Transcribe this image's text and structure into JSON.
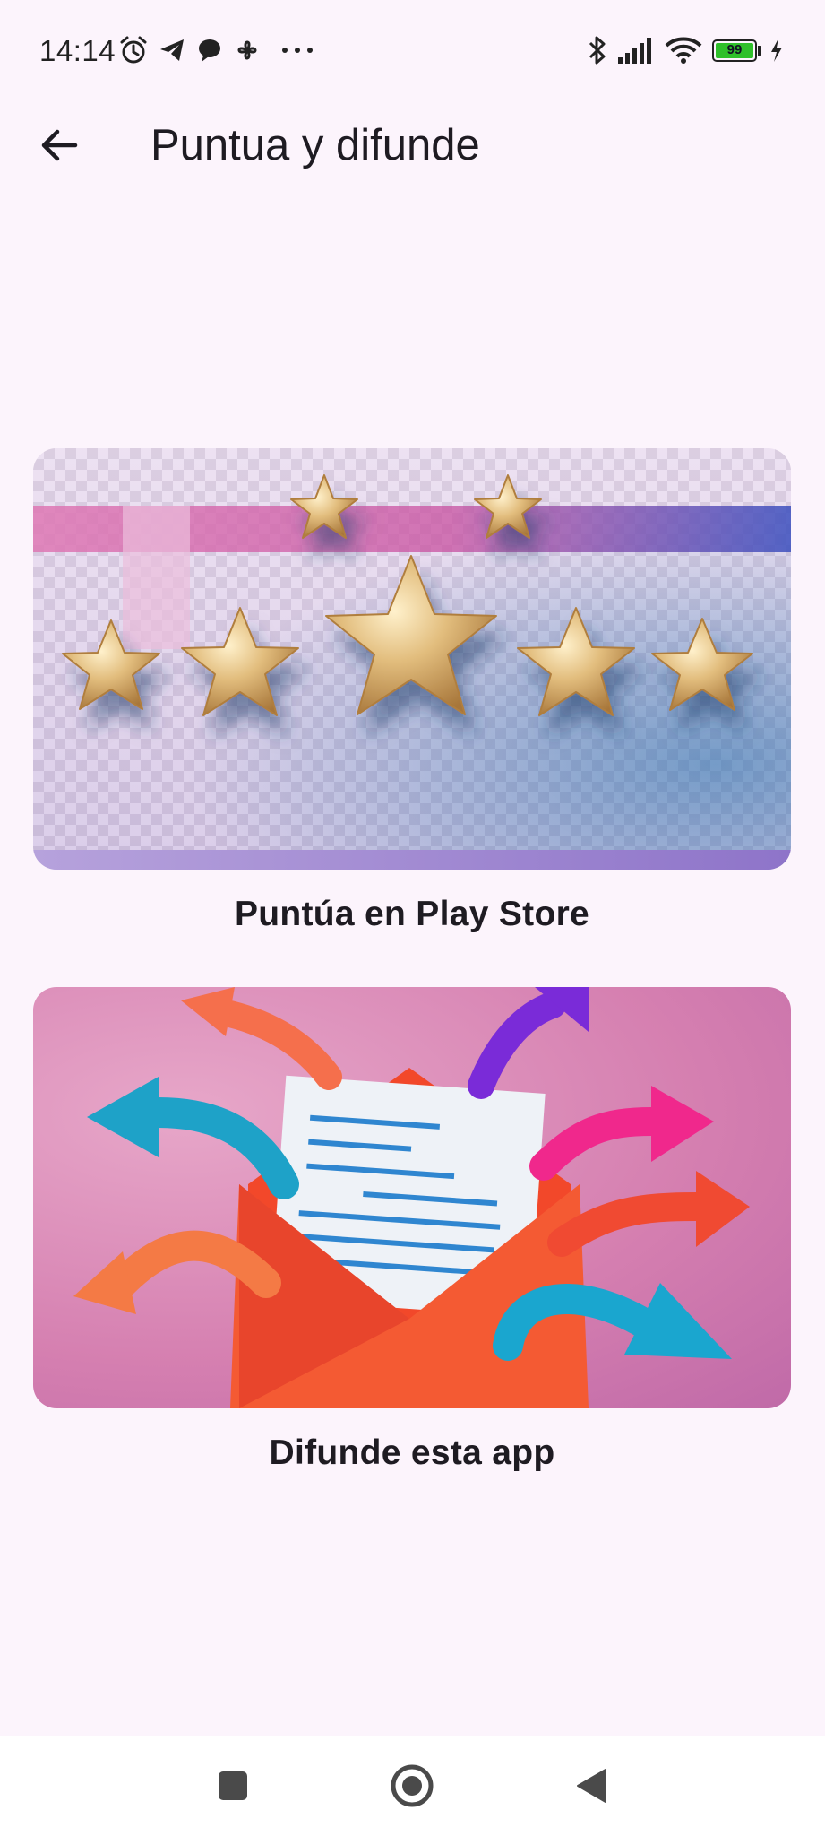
{
  "status_bar": {
    "time": "14:14",
    "notification_icons": [
      "alarm-icon",
      "telegram-icon",
      "chat-bubble-icon",
      "pinwheel-icon",
      "more-dots-icon"
    ],
    "system_icons": [
      "bluetooth-icon",
      "signal-icon",
      "wifi-icon",
      "battery-icon",
      "charging-icon"
    ],
    "battery_level": "99",
    "battery_color": "#2FC02A"
  },
  "app_bar": {
    "title": "Puntua y difunde",
    "back_icon": "arrow-back-icon"
  },
  "cards": [
    {
      "label": "Puntúa en Play Store",
      "image": "five-gold-stars-illustration"
    },
    {
      "label": "Difunde esta app",
      "image": "envelope-with-arrows-illustration"
    }
  ],
  "nav_bar": {
    "buttons": [
      "recents-square-icon",
      "home-circle-icon",
      "back-triangle-icon"
    ]
  },
  "colors": {
    "background": "#FCF4FC",
    "text": "#1E1B22",
    "nav_background": "#FFFFFF"
  }
}
